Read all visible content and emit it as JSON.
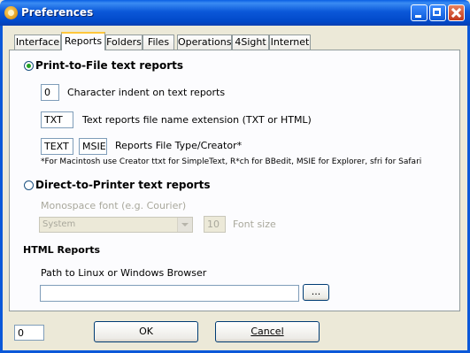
{
  "window": {
    "title": "Preferences"
  },
  "tabs": [
    {
      "label": "Interface",
      "active": false
    },
    {
      "label": "Reports",
      "active": true
    },
    {
      "label": "Folders",
      "active": false
    },
    {
      "label": "Files",
      "active": false
    },
    {
      "label": "Operations",
      "active": false
    },
    {
      "label": "4Sight",
      "active": false
    },
    {
      "label": "Internet",
      "active": false
    }
  ],
  "print_to_file": {
    "label": "Print-to-File text reports",
    "selected": true,
    "indent_value": "0",
    "indent_label": "Character indent on text reports",
    "extension_value": "TXT",
    "extension_label": "Text reports file name extension (TXT or HTML)",
    "type_value": "TEXT",
    "creator_value": "MSIE",
    "type_creator_label": "Reports File Type/Creator*",
    "note": "*For Macintosh use Creator ttxt for SimpleText, R*ch for BBedit, MSIE for Explorer, sfri for Safari"
  },
  "direct_to_printer": {
    "label": "Direct-to-Printer text reports",
    "selected": false,
    "font_label": "Monospace font (e.g. Courier)",
    "font_value": "System",
    "size_value": "10",
    "size_label": "Font size"
  },
  "html_reports": {
    "heading": "HTML Reports",
    "path_label": "Path to Linux or Windows Browser",
    "path_value": "",
    "browse_label": "..."
  },
  "footer": {
    "field_value": "0",
    "ok_label": "OK",
    "cancel_label": "Cancel"
  },
  "colors": {
    "title_bar": "#0b58d9",
    "active_tab_accent": "#ffc73c",
    "radio_dot": "#21a121"
  },
  "icons": {
    "app": "orange-gear-icon"
  }
}
